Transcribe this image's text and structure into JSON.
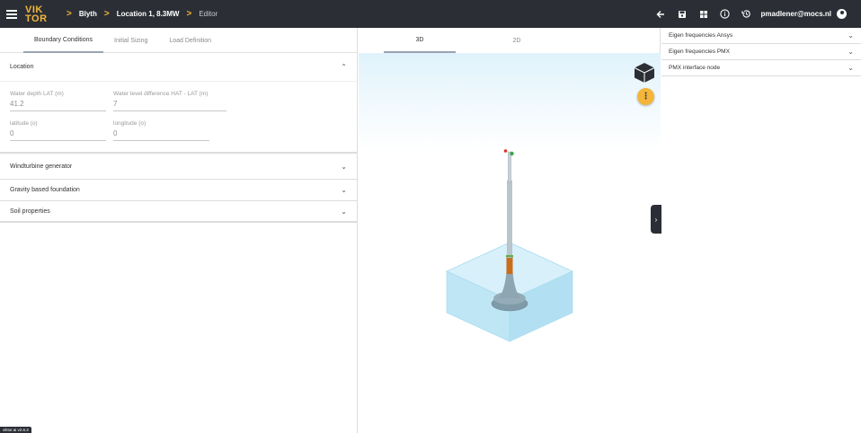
{
  "header": {
    "logo_line1": "VIK",
    "logo_line2": "TOR",
    "breadcrumbs": [
      "Blyth",
      "Location 1, 8.3MW",
      "Editor"
    ],
    "user": "pmadlener@mocs.nl",
    "icons": [
      "menu-icon",
      "back-arrow-icon",
      "save-icon",
      "dashboard-icon",
      "info-icon",
      "history-icon",
      "account-icon"
    ]
  },
  "left": {
    "tabs": [
      {
        "label": "Boundary Conditions"
      },
      {
        "label": "Initial Sizing"
      },
      {
        "label": "Load Definition"
      }
    ],
    "location": {
      "title": "Location",
      "fields": [
        {
          "label": "Water depth LAT (m)",
          "value": "41.2"
        },
        {
          "label": "Water level difference HAT - LAT (m)",
          "value": "7"
        },
        {
          "label": "latitude (o)",
          "value": "0"
        },
        {
          "label": "longitude (o)",
          "value": "0"
        }
      ]
    },
    "sections": [
      {
        "title": "Windturbine generator"
      },
      {
        "title": "Gravity based foundation"
      },
      {
        "title": "Soil properties"
      }
    ],
    "version": "viktor.ai v2.6.3"
  },
  "view": {
    "tabs": [
      {
        "label": "3D"
      },
      {
        "label": "2D"
      }
    ],
    "fab_symbol": "⋮"
  },
  "right": {
    "items": [
      {
        "label": "Eigen frequencies Ansys"
      },
      {
        "label": "Eigen frequencies PMX"
      },
      {
        "label": "PMX interface node"
      }
    ]
  },
  "colors": {
    "topbar": "#2b2f35",
    "accent": "#f3b63a",
    "water": "#bfe6f5"
  }
}
